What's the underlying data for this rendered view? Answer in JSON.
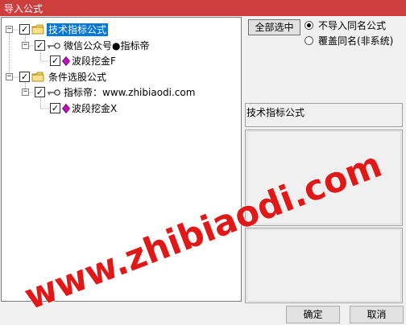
{
  "window": {
    "title": "导入公式"
  },
  "tree": {
    "items": [
      {
        "label": "技术指标公式",
        "type": "folder",
        "checked": true,
        "expanded": true,
        "selected": true
      },
      {
        "label": "微信公众号●指标帝",
        "type": "key",
        "checked": true,
        "expanded": true,
        "selected": false
      },
      {
        "label": "波段挖金F",
        "type": "formula",
        "checked": true,
        "selected": false
      },
      {
        "label": "条件选股公式",
        "type": "folder",
        "checked": true,
        "expanded": true,
        "selected": false
      },
      {
        "label": "指标帝：www.zhibiaodi.com",
        "type": "key",
        "checked": true,
        "expanded": true,
        "selected": false
      },
      {
        "label": "波段挖金X",
        "type": "formula",
        "checked": true,
        "selected": false
      }
    ],
    "expander_symbol": "−",
    "check_symbol": "✓"
  },
  "options": {
    "select_all_label": "全部选中",
    "radio_no_import": "不导入同名公式",
    "radio_overwrite": "覆盖同名(非系统)",
    "selected_radio": "radio_no_import"
  },
  "info": {
    "category_label": "技术指标公式"
  },
  "buttons": {
    "ok_label": "确定",
    "cancel_label": "取消"
  },
  "watermark": {
    "text": "www.zhibiaodi.com",
    "color": "#e01818"
  },
  "colors": {
    "titlebar": "#cd3f3c",
    "selection": "#0078d7",
    "folder": "#f4d266",
    "formula": "#c010c0"
  }
}
